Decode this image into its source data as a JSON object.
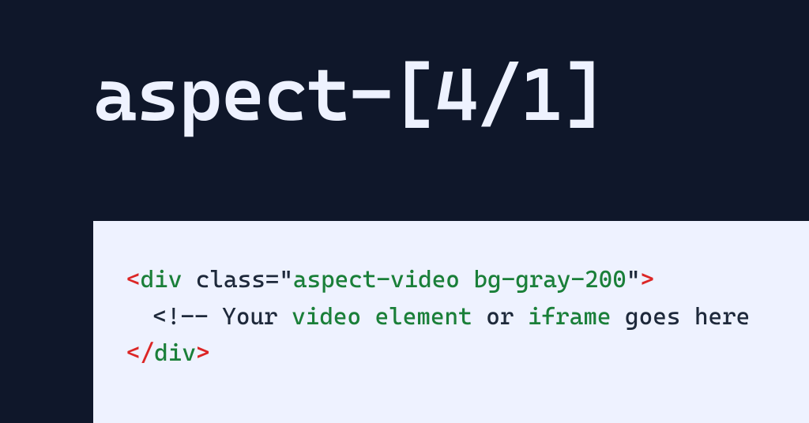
{
  "heading": "aspect-[4/1]",
  "code": {
    "line1": {
      "open_lt": "<",
      "tag": "div",
      "space1": " ",
      "attr_name": "class",
      "eq": "=",
      "quote_open": "\"",
      "attr_value": "aspect-video bg-gray-200",
      "quote_close": "\"",
      "open_gt": ">"
    },
    "line2": {
      "cmt_open": "<!-- ",
      "w1": "Your ",
      "kw1": "video",
      "sp1": " ",
      "kw2": "element",
      "w2": " or ",
      "kw3": "iframe",
      "w3": " goes here"
    },
    "line3": {
      "close_lt": "</",
      "tag": "div",
      "close_gt": ">"
    }
  }
}
